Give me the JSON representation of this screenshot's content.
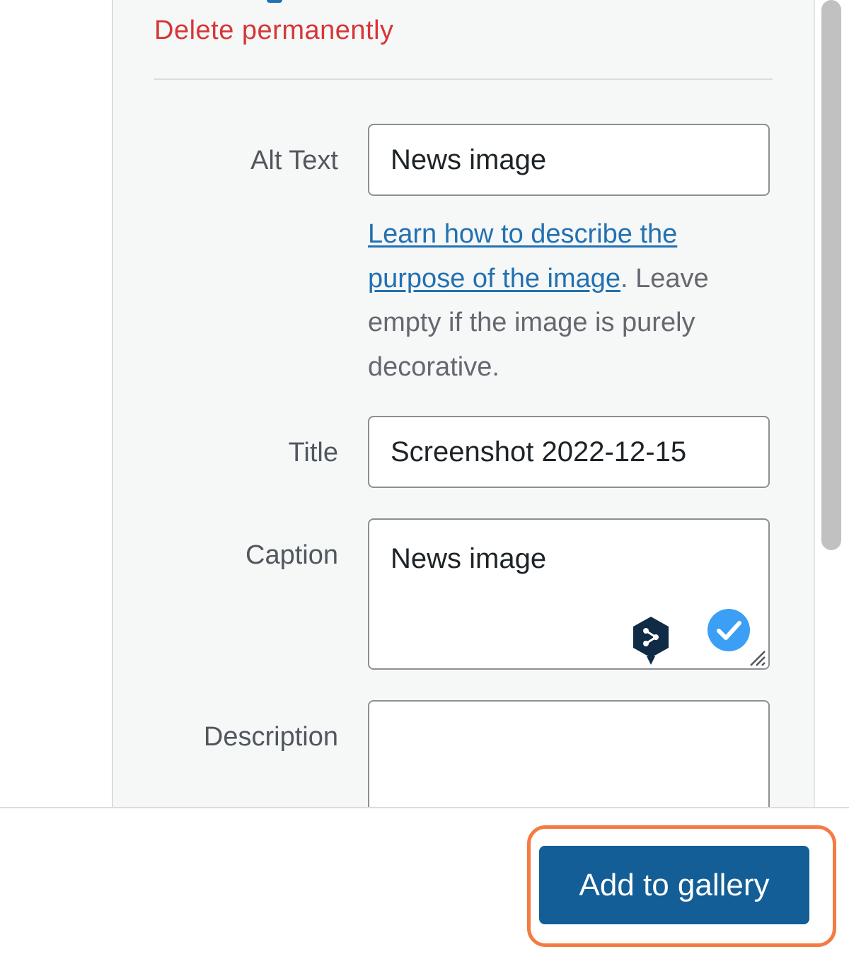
{
  "attachment_actions": {
    "delete_label": "Delete permanently"
  },
  "fields": {
    "alt_text": {
      "label": "Alt Text",
      "value": "News image",
      "help_link": "Learn how to describe the purpose of the image",
      "help_suffix": ". Leave empty if the image is purely decorative."
    },
    "title": {
      "label": "Title",
      "value": "Screenshot 2022-12-15"
    },
    "caption": {
      "label": "Caption",
      "value": "News image"
    },
    "description": {
      "label": "Description",
      "value": ""
    }
  },
  "icons": {
    "translator": "deepl-share-icon",
    "grammar_check": "check-circle-icon",
    "resize": "resize-handle-icon"
  },
  "toolbar": {
    "primary_label": "Add to gallery"
  },
  "colors": {
    "danger": "#d63638",
    "link": "#2271b1",
    "primary_button": "#135e96",
    "highlight": "#f47b42",
    "check_badge": "#3ba0f5"
  }
}
